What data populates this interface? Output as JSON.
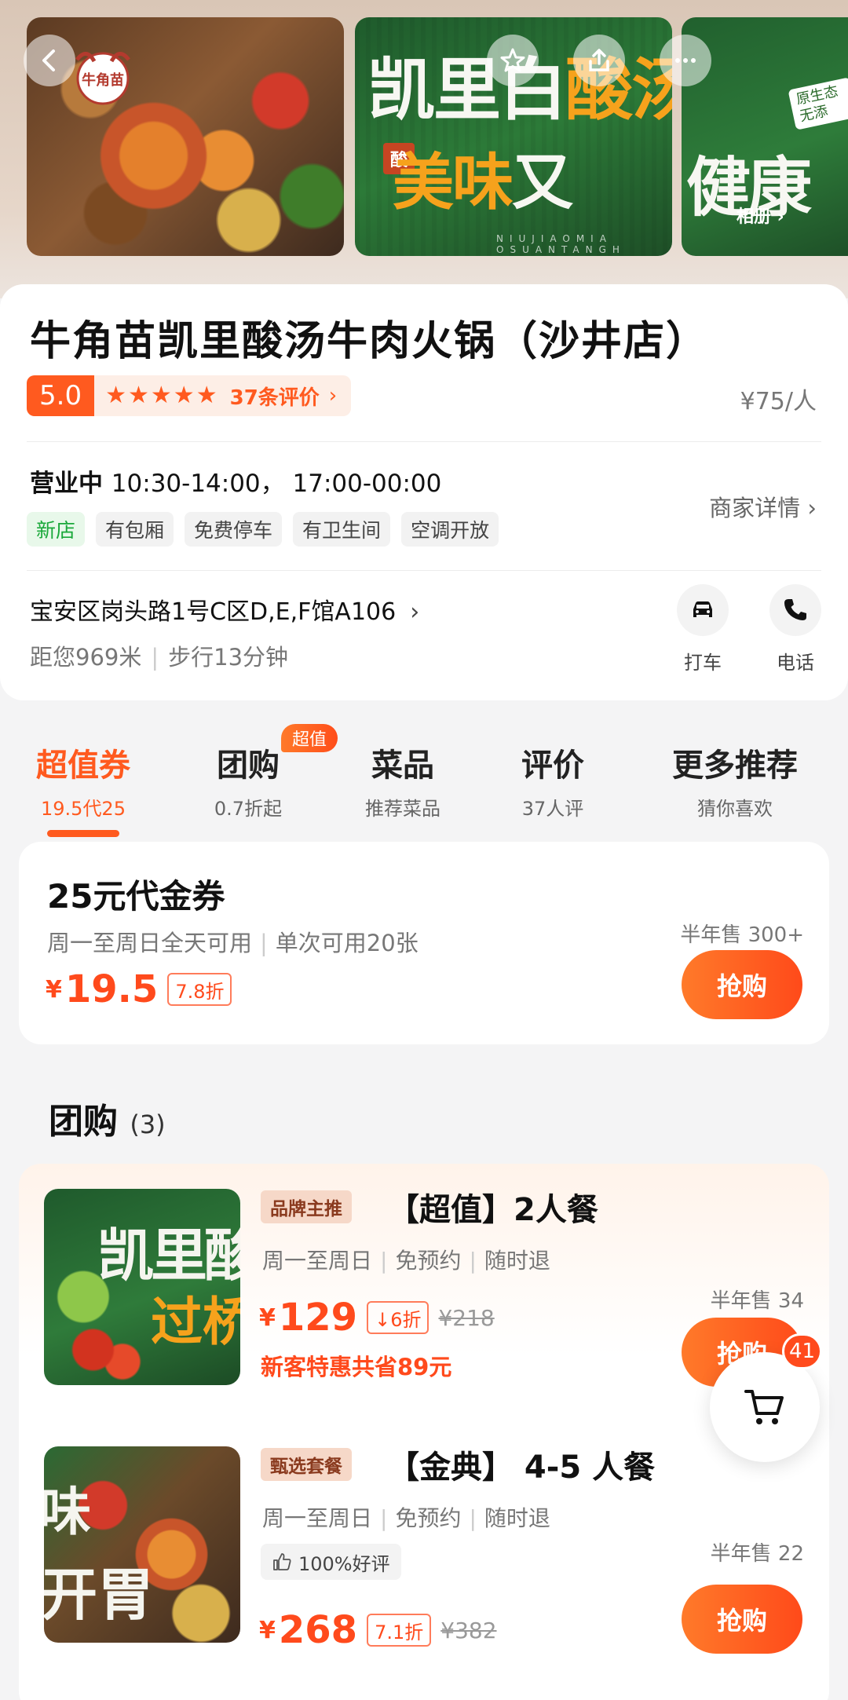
{
  "hero": {
    "poster_line1_white": "凯里",
    "poster_line1_orange_a": "白",
    "poster_line1_orange_b": "酸汤",
    "poster_line2_orange": "美味",
    "poster_line2_white": "又",
    "poster_stamp": "酸",
    "poster_sub": "NIUJIAOMIA OSUANTANGH",
    "photo3_top": "",
    "photo3_big": "健康",
    "photo3_badge": "原生态 无添",
    "album_label": "相册 ›",
    "logo_text": "牛角苗"
  },
  "shop": {
    "name": "牛角苗凯里酸汤牛肉火锅（沙井店）",
    "rating": "5.0",
    "stars": [
      "★",
      "★",
      "★",
      "★",
      "★"
    ],
    "review_count": "37条评价",
    "review_chevron": "›",
    "per_person": "¥75/人",
    "status": "营业中",
    "hours": "10:30-14:00， 17:00-00:00",
    "tags": [
      "新店",
      "有包厢",
      "免费停车",
      "有卫生间",
      "空调开放"
    ],
    "merchant_detail": "商家详情 ›",
    "address": "宝安区岗头路1号C区D,E,F馆A106",
    "address_chevron": "›",
    "distance": "距您969米",
    "walk": "步行13分钟",
    "taxi_label": "打车",
    "call_label": "电话"
  },
  "tabs": [
    {
      "title": "超值券",
      "sub": "19.5代25",
      "active": true
    },
    {
      "title": "团购",
      "sub": "0.7折起",
      "active": false
    },
    {
      "title": "菜品",
      "sub": "推荐菜品",
      "active": false
    },
    {
      "title": "评价",
      "sub": "37人评",
      "active": false
    },
    {
      "title": "更多推荐",
      "sub": "猜你喜欢",
      "active": false
    }
  ],
  "tab_badge": "超值",
  "voucher": {
    "title": "25元代金券",
    "desc_a": "周一至周日全天可用",
    "desc_b": "单次可用20张",
    "yen": "¥",
    "price": "19.5",
    "discount": "7.8折",
    "sold": "半年售 300+",
    "buy": "抢购"
  },
  "group": {
    "heading": "团购",
    "count": "(3)",
    "deals": [
      {
        "img_t1": "凯里酸",
        "img_t2": "过桥",
        "tag": "品牌主推",
        "title": "【超值】2人餐",
        "meta_a": "周一至周日",
        "meta_b": "免预约",
        "meta_c": "随时退",
        "yen": "¥",
        "price": "129",
        "discount": "↓6折",
        "orig": "¥218",
        "save": "新客特惠共省89元",
        "sold": "半年售 34",
        "buy": "抢购"
      },
      {
        "img_t1": "味",
        "img_t2": "开胃",
        "tag": "甄选套餐",
        "title": "【金典】 4-5 人餐",
        "meta_a": "周一至周日",
        "meta_b": "免预约",
        "meta_c": "随时退",
        "praise": "100%好评",
        "yen": "¥",
        "price": "268",
        "discount": "7.1折",
        "orig": "¥382",
        "sold": "半年售 22",
        "buy": "抢购"
      }
    ]
  },
  "cart": {
    "badge": "41"
  },
  "icons": {
    "back": "back-arrow-icon",
    "favorite": "star-outline-icon",
    "share": "share-icon",
    "more": "more-dots-icon",
    "taxi": "car-icon",
    "call": "phone-icon",
    "cart": "cart-icon",
    "praise": "thumbs-up-icon"
  },
  "colors": {
    "accent": "#ff5a1f",
    "price": "#ff4a1c",
    "new_tag": "#1aa83a",
    "poster_green": "#2c7a38",
    "poster_orange": "#f6a21c"
  }
}
